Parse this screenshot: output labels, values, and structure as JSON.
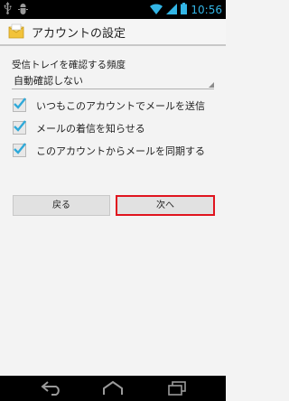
{
  "status_bar": {
    "time": "10:56",
    "icons": [
      "usb-icon",
      "debug-icon",
      "wifi-icon",
      "signal-icon",
      "battery-icon"
    ]
  },
  "action_bar": {
    "title": "アカウントの設定",
    "icon": "email-app-icon"
  },
  "sync": {
    "label": "受信トレイを確認する頻度",
    "value": "自動確認しない"
  },
  "options": [
    {
      "label": "いつもこのアカウントでメールを送信",
      "checked": true
    },
    {
      "label": "メールの着信を知らせる",
      "checked": true
    },
    {
      "label": "このアカウントからメールを同期する",
      "checked": true
    }
  ],
  "buttons": {
    "back": "戻る",
    "next": "次へ"
  },
  "colors": {
    "accent": "#33b5e5",
    "highlight": "#e0141e",
    "check": "#2fa9d9"
  },
  "nav_bar": {
    "icons": [
      "back-icon",
      "home-icon",
      "recent-apps-icon"
    ]
  }
}
